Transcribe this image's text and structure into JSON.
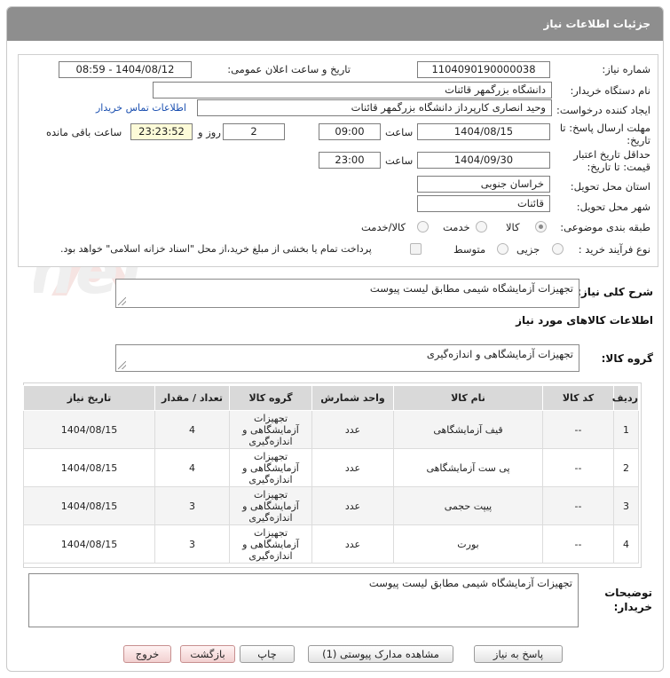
{
  "header": {
    "title": "جزئیات اطلاعات نیاز"
  },
  "info": {
    "need_number_label": "شماره نیاز:",
    "need_number": "1104090190000038",
    "announce_label": "تاریخ و ساعت اعلان عمومی:",
    "announce_value": "1404/08/12 - 08:59",
    "buyer_label": "نام دستگاه خریدار:",
    "buyer_value": "دانشگاه بزرگمهر قائنات",
    "creator_label": "ایجاد کننده درخواست:",
    "creator_value": "وحید انصاری کارپرداز دانشگاه بزرگمهر قائنات",
    "contact_link": "اطلاعات تماس خریدار",
    "deadline_label_1": "مهلت ارسال پاسخ: تا",
    "deadline_label_2": "تاریخ:",
    "deadline_date": "1404/08/15",
    "time_label": "ساعت",
    "deadline_time": "09:00",
    "days_value": "2",
    "days_label": "روز و",
    "remaining_time": "23:23:52",
    "remaining_label": "ساعت باقی مانده",
    "validity_label_1": "حداقل تاریخ اعتبار",
    "validity_label_2": "قیمت: تا تاریخ:",
    "validity_date": "1404/09/30",
    "validity_time": "23:00",
    "province_label": "استان محل تحویل:",
    "province_value": "خراسان جنوبی",
    "city_label": "شهر محل تحویل:",
    "city_value": "قائنات",
    "category_label": "طبقه بندی موضوعی:",
    "category_options": [
      "کالا",
      "خدمت",
      "کالا/خدمت"
    ],
    "category_selected": "کالا",
    "process_label": "نوع فرآیند خرید :",
    "process_options": [
      "جزیی",
      "متوسط"
    ],
    "payment_note": "پرداخت تمام یا بخشی از مبلغ خرید،از محل \"اسناد خزانه اسلامی\" خواهد بود."
  },
  "description": {
    "label": "شرح کلی نیاز:",
    "value": "تجهیزات آزمایشگاه شیمی مطابق لیست پیوست"
  },
  "goods": {
    "section_title": "اطلاعات کالاهای مورد نیاز",
    "group_label": "گروه کالا:",
    "group_value": "تجهیزات آزمایشگاهی و اندازه‌گیری",
    "columns": [
      "ردیف",
      "کد کالا",
      "نام کالا",
      "واحد شمارش",
      "گروه کالا",
      "تعداد / مقدار",
      "تاریخ نیاز"
    ],
    "rows": [
      {
        "idx": "1",
        "code": "--",
        "name": "قیف آزمایشگاهی",
        "unit": "عدد",
        "group": "تجهیزات آزمایشگاهی و اندازه‌گیری",
        "qty": "4",
        "date": "1404/08/15"
      },
      {
        "idx": "2",
        "code": "--",
        "name": "پی ست آزمایشگاهی",
        "unit": "عدد",
        "group": "تجهیزات آزمایشگاهی و اندازه‌گیری",
        "qty": "4",
        "date": "1404/08/15"
      },
      {
        "idx": "3",
        "code": "--",
        "name": "پیپت حجمی",
        "unit": "عدد",
        "group": "تجهیزات آزمایشگاهی و اندازه‌گیری",
        "qty": "3",
        "date": "1404/08/15"
      },
      {
        "idx": "4",
        "code": "--",
        "name": "بورت",
        "unit": "عدد",
        "group": "تجهیزات آزمایشگاهی و اندازه‌گیری",
        "qty": "3",
        "date": "1404/08/15"
      }
    ]
  },
  "buyer_notes": {
    "label_1": "توضیحات",
    "label_2": "خریدار:",
    "value": "تجهیزات آزمایشگاه شیمی مطابق لیست پیوست"
  },
  "buttons": {
    "reply": "پاسخ به نیاز",
    "attachments": "مشاهده مدارک پیوستی (1)",
    "print": "چاپ",
    "back": "بازگشت",
    "exit": "خروج"
  },
  "watermark_text": "AriaTender.net",
  "colors": {
    "header_bg": "#8e8e8e",
    "link": "#1a4fb0",
    "time_bg": "#fdfbd8",
    "table_head": "#d9d9d9",
    "exit_btn": "#f2d0d0"
  }
}
